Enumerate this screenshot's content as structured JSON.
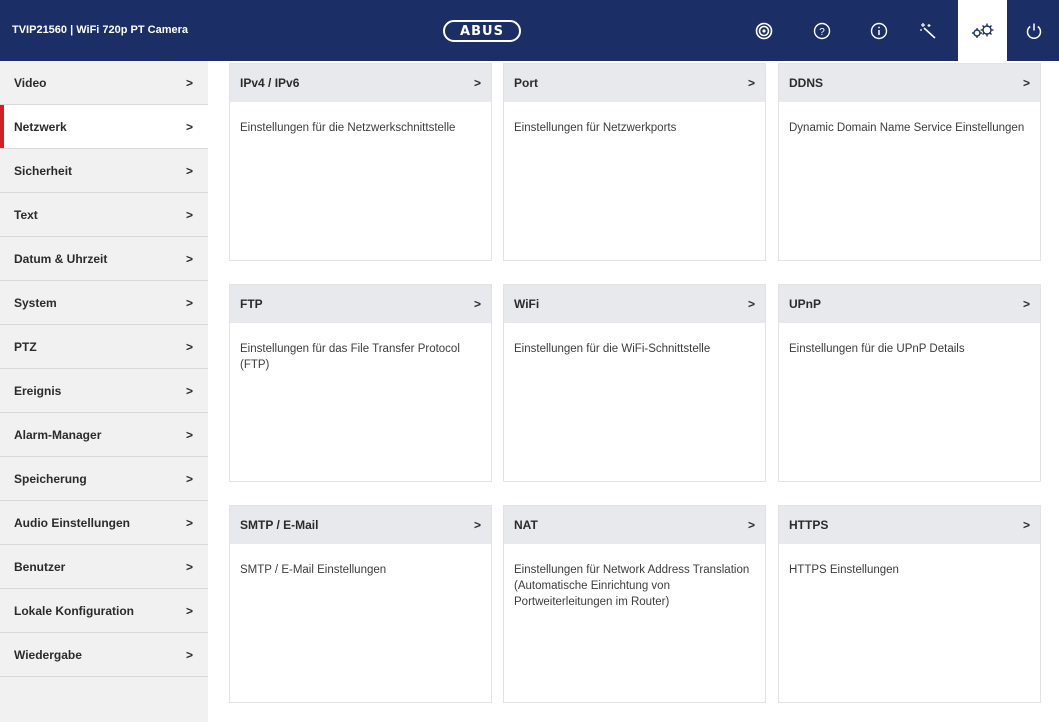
{
  "header": {
    "device_title": "TVIP21560  |  WiFi 720p PT Camera",
    "logo_text": "ABUS",
    "icons": [
      "live-view-icon",
      "help-icon",
      "info-icon",
      "wizard-icon",
      "settings-icon",
      "power-icon"
    ],
    "active_icon": "settings-icon"
  },
  "sidebar": {
    "items": [
      {
        "label": "Video",
        "chevron": ">"
      },
      {
        "label": "Netzwerk",
        "chevron": ">"
      },
      {
        "label": "Sicherheit",
        "chevron": ">"
      },
      {
        "label": "Text",
        "chevron": ">"
      },
      {
        "label": "Datum & Uhrzeit",
        "chevron": ">"
      },
      {
        "label": "System",
        "chevron": ">"
      },
      {
        "label": "PTZ",
        "chevron": ">"
      },
      {
        "label": "Ereignis",
        "chevron": ">"
      },
      {
        "label": "Alarm-Manager",
        "chevron": ">"
      },
      {
        "label": "Speicherung",
        "chevron": ">"
      },
      {
        "label": "Audio Einstellungen",
        "chevron": ">"
      },
      {
        "label": "Benutzer",
        "chevron": ">"
      },
      {
        "label": "Lokale Konfiguration",
        "chevron": ">"
      },
      {
        "label": "Wiedergabe",
        "chevron": ">"
      }
    ],
    "active": "Netzwerk"
  },
  "cards": [
    {
      "title": "IPv4 / IPv6",
      "chevron": ">",
      "description": "Einstellungen für die Netzwerkschnittstelle"
    },
    {
      "title": "Port",
      "chevron": ">",
      "description": "Einstellungen für Netzwerkports"
    },
    {
      "title": "DDNS",
      "chevron": ">",
      "description": "Dynamic Domain Name Service Einstellungen"
    },
    {
      "title": "FTP",
      "chevron": ">",
      "description": "Einstellungen für das File Transfer Protocol (FTP)"
    },
    {
      "title": "WiFi",
      "chevron": ">",
      "description": "Einstellungen für die WiFi-Schnittstelle"
    },
    {
      "title": "UPnP",
      "chevron": ">",
      "description": "Einstellungen für die UPnP Details"
    },
    {
      "title": "SMTP / E-Mail",
      "chevron": ">",
      "description": "SMTP / E-Mail Einstellungen"
    },
    {
      "title": "NAT",
      "chevron": ">",
      "description": "Einstellungen für Network Address Translation (Automatische Einrichtung von Portweiterleitungen im Router)"
    },
    {
      "title": "HTTPS",
      "chevron": ">",
      "description": "HTTPS Einstellungen"
    }
  ],
  "colors": {
    "header_bg": "#1b2f66",
    "active_marker": "#d41f26",
    "sidebar_bg": "#f1f1f1",
    "card_header_bg": "#e8e9ec"
  }
}
